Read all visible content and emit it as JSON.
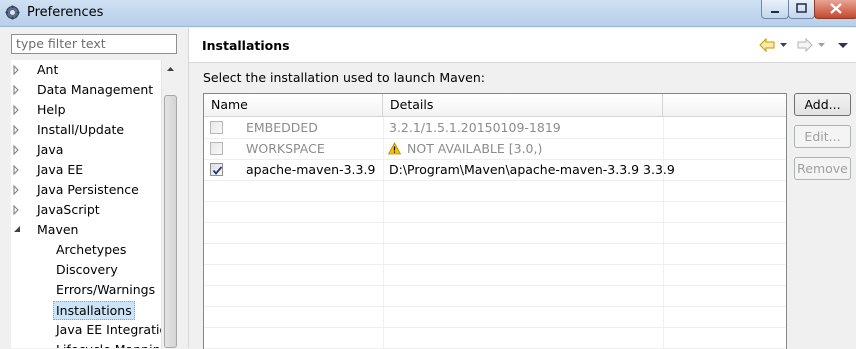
{
  "window": {
    "title": "Preferences"
  },
  "filter": {
    "placeholder": "type filter text"
  },
  "tree": {
    "items": [
      {
        "label": "Ant",
        "expanded": false
      },
      {
        "label": "Data Management",
        "expanded": false
      },
      {
        "label": "Help",
        "expanded": false
      },
      {
        "label": "Install/Update",
        "expanded": false
      },
      {
        "label": "Java",
        "expanded": false
      },
      {
        "label": "Java EE",
        "expanded": false
      },
      {
        "label": "Java Persistence",
        "expanded": false
      },
      {
        "label": "JavaScript",
        "expanded": false
      },
      {
        "label": "Maven",
        "expanded": true
      }
    ],
    "maven_children": [
      {
        "label": "Archetypes"
      },
      {
        "label": "Discovery"
      },
      {
        "label": "Errors/Warnings"
      },
      {
        "label": "Installations",
        "selected": true
      },
      {
        "label": "Java EE Integration"
      },
      {
        "label": "Lifecycle Mappings"
      }
    ]
  },
  "page": {
    "title": "Installations",
    "description": "Select the installation used to launch Maven:"
  },
  "table": {
    "columns": [
      "Name",
      "Details"
    ],
    "rows": [
      {
        "checked": false,
        "enabled": false,
        "name": "EMBEDDED",
        "details": "3.2.1/1.5.1.20150109-1819",
        "warning": false
      },
      {
        "checked": false,
        "enabled": false,
        "name": "WORKSPACE",
        "details": "NOT AVAILABLE [3.0,)",
        "warning": true
      },
      {
        "checked": true,
        "enabled": true,
        "name": "apache-maven-3.3.9",
        "details": "D:\\Program\\Maven\\apache-maven-3.3.9 3.3.9",
        "warning": false
      }
    ]
  },
  "buttons": {
    "add": "Add...",
    "edit": "Edit...",
    "remove": "Remove"
  },
  "colors": {
    "accent": "#d9a000",
    "selection": "#cce4f7"
  }
}
